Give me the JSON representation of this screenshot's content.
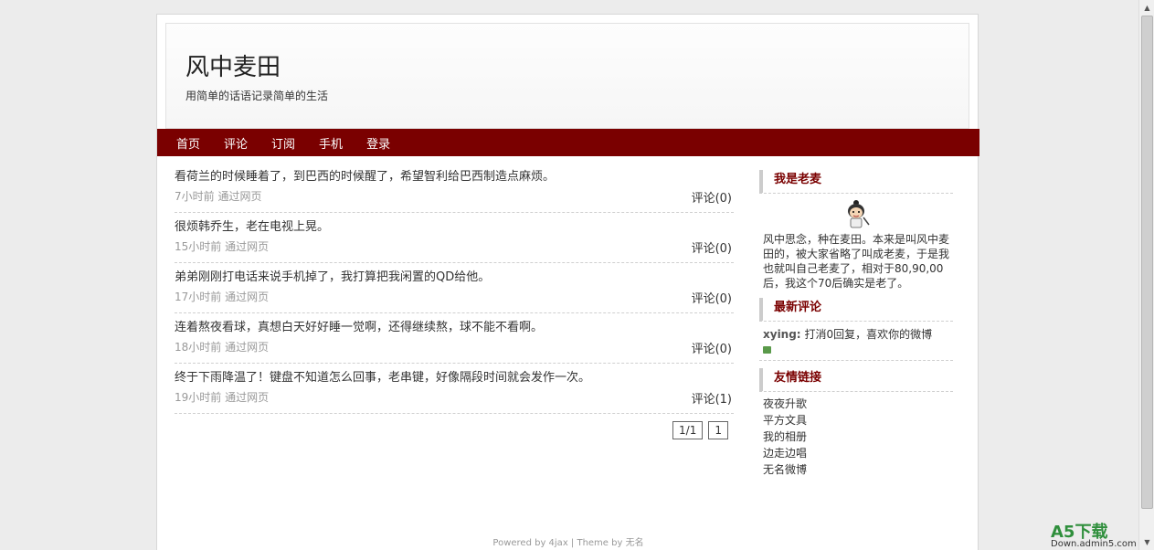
{
  "header": {
    "title": "风中麦田",
    "subtitle": "用简单的话语记录简单的生活"
  },
  "nav": {
    "items": [
      "首页",
      "评论",
      "订阅",
      "手机",
      "登录"
    ]
  },
  "posts": [
    {
      "text": "看荷兰的时候睡着了，到巴西的时候醒了，希望智利给巴西制造点麻烦。",
      "meta": "7小时前 通过网页",
      "comment": "评论(0)"
    },
    {
      "text": "很烦韩乔生，老在电视上晃。",
      "meta": "15小时前 通过网页",
      "comment": "评论(0)"
    },
    {
      "text": "弟弟刚刚打电话来说手机掉了，我打算把我闲置的QD给他。",
      "meta": "17小时前 通过网页",
      "comment": "评论(0)"
    },
    {
      "text": "连着熬夜看球，真想白天好好睡一觉啊，还得继续熬，球不能不看啊。",
      "meta": "18小时前 通过网页",
      "comment": "评论(0)"
    },
    {
      "text": "终于下雨降温了！键盘不知道怎么回事，老串键，好像隔段时间就会发作一次。",
      "meta": "19小时前 通过网页",
      "comment": "评论(1)"
    }
  ],
  "pager": {
    "summary": "1/1",
    "page": "1"
  },
  "sidebar": {
    "about_title": "我是老麦",
    "about_text": "风中思念，种在麦田。本来是叫风中麦田的，被大家省略了叫成老麦，于是我也就叫自己老麦了，相对于80,90,00后，我这个70后确实是老了。",
    "comments_title": "最新评论",
    "comment_user": "xying:",
    "comment_text": "打消0回复，喜欢你的微博",
    "links_title": "友情链接",
    "links": [
      "夜夜升歌",
      "平方文具",
      "我的相册",
      "边走边唱",
      "无名微博"
    ]
  },
  "footer": {
    "text": "Powered by 4jax | Theme by 无名"
  },
  "watermark": {
    "big": "A5下载",
    "small": "Down.admin5.com"
  },
  "colors": {
    "nav_bg": "#7a0000",
    "widget_title": "#7a0000"
  }
}
